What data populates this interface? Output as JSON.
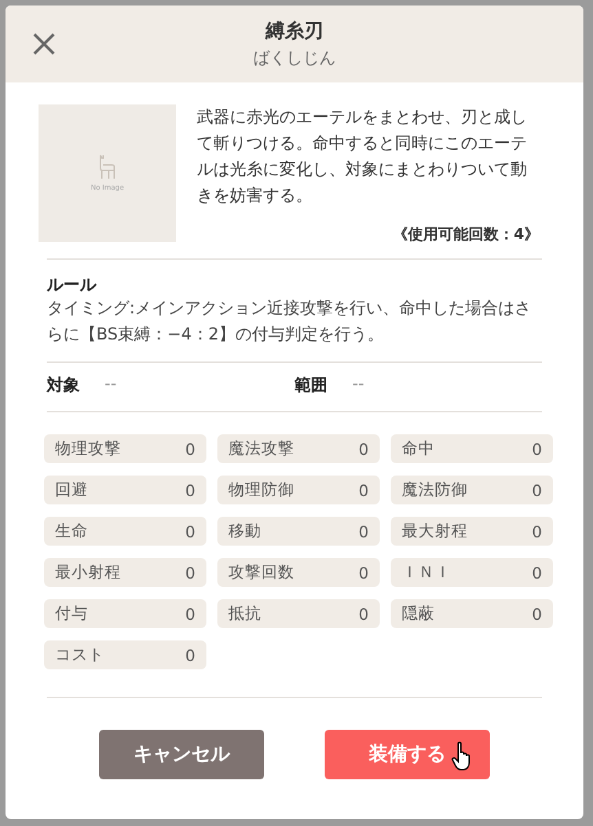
{
  "dialog": {
    "title": "縛糸刃",
    "reading": "ばくしじん"
  },
  "image": {
    "label": "No Image"
  },
  "description": "武器に赤光のエーテルをまとわせ、刃と成して斬りつける。命中すると同時にこのエーテルは光糸に変化し、対象にまとわりついて動きを妨害する。",
  "uses": "《使用可能回数：4》",
  "rule": {
    "heading": "ルール",
    "text": "タイミング:メインアクション近接攻撃を行い、命中した場合はさらに【BS束縛：−4：2】の付与判定を行う。"
  },
  "fields": [
    {
      "label": "対象",
      "value": "--"
    },
    {
      "label": "範囲",
      "value": "--"
    }
  ],
  "stats": [
    {
      "label": "物理攻撃",
      "value": "0"
    },
    {
      "label": "魔法攻撃",
      "value": "0"
    },
    {
      "label": "命中",
      "value": "0"
    },
    {
      "label": "回避",
      "value": "0"
    },
    {
      "label": "物理防御",
      "value": "0"
    },
    {
      "label": "魔法防御",
      "value": "0"
    },
    {
      "label": "生命",
      "value": "0"
    },
    {
      "label": "移動",
      "value": "0"
    },
    {
      "label": "最大射程",
      "value": "0"
    },
    {
      "label": "最小射程",
      "value": "0"
    },
    {
      "label": "攻撃回数",
      "value": "0"
    },
    {
      "label": "ＩＮＩ",
      "value": "0"
    },
    {
      "label": "付与",
      "value": "0"
    },
    {
      "label": "抵抗",
      "value": "0"
    },
    {
      "label": "隠蔽",
      "value": "0"
    },
    {
      "label": "コスト",
      "value": "0"
    }
  ],
  "buttons": [
    {
      "label": "キャンセル",
      "kind": "secondary"
    },
    {
      "label": "装備する",
      "kind": "primary",
      "hovered": true
    }
  ]
}
